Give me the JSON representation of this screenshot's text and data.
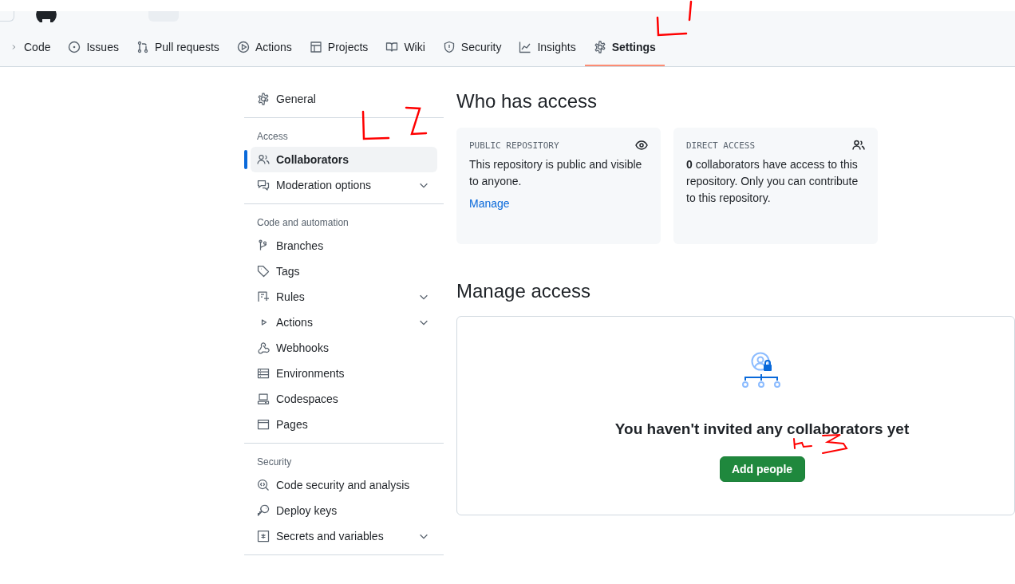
{
  "repo_nav": {
    "tabs": [
      {
        "label": "Code",
        "selected": false
      },
      {
        "label": "Issues",
        "selected": false
      },
      {
        "label": "Pull requests",
        "selected": false
      },
      {
        "label": "Actions",
        "selected": false
      },
      {
        "label": "Projects",
        "selected": false
      },
      {
        "label": "Wiki",
        "selected": false
      },
      {
        "label": "Security",
        "selected": false
      },
      {
        "label": "Insights",
        "selected": false
      },
      {
        "label": "Settings",
        "selected": true
      }
    ]
  },
  "sidebar": {
    "sections": [
      {
        "items": [
          {
            "label": "General",
            "selected": false,
            "expandable": false
          }
        ]
      },
      {
        "heading": "Access",
        "items": [
          {
            "label": "Collaborators",
            "selected": true,
            "expandable": false
          },
          {
            "label": "Moderation options",
            "selected": false,
            "expandable": true
          }
        ]
      },
      {
        "heading": "Code and automation",
        "items": [
          {
            "label": "Branches",
            "selected": false,
            "expandable": false
          },
          {
            "label": "Tags",
            "selected": false,
            "expandable": false
          },
          {
            "label": "Rules",
            "selected": false,
            "expandable": true
          },
          {
            "label": "Actions",
            "selected": false,
            "expandable": true
          },
          {
            "label": "Webhooks",
            "selected": false,
            "expandable": false
          },
          {
            "label": "Environments",
            "selected": false,
            "expandable": false
          },
          {
            "label": "Codespaces",
            "selected": false,
            "expandable": false
          },
          {
            "label": "Pages",
            "selected": false,
            "expandable": false
          }
        ]
      },
      {
        "heading": "Security",
        "items": [
          {
            "label": "Code security and analysis",
            "selected": false,
            "expandable": false
          },
          {
            "label": "Deploy keys",
            "selected": false,
            "expandable": false
          },
          {
            "label": "Secrets and variables",
            "selected": false,
            "expandable": true
          }
        ]
      }
    ]
  },
  "who_has_access": {
    "title": "Who has access",
    "cards": [
      {
        "heading": "PUBLIC REPOSITORY",
        "text": "This repository is public and visible to anyone.",
        "link": "Manage"
      },
      {
        "heading": "DIRECT ACCESS",
        "text": "**0** collaborators have access to this repository. Only you can contribute to this repository."
      }
    ]
  },
  "manage_access": {
    "title": "Manage access",
    "empty_message": "You haven't invited any collaborators yet",
    "button": "Add people"
  }
}
